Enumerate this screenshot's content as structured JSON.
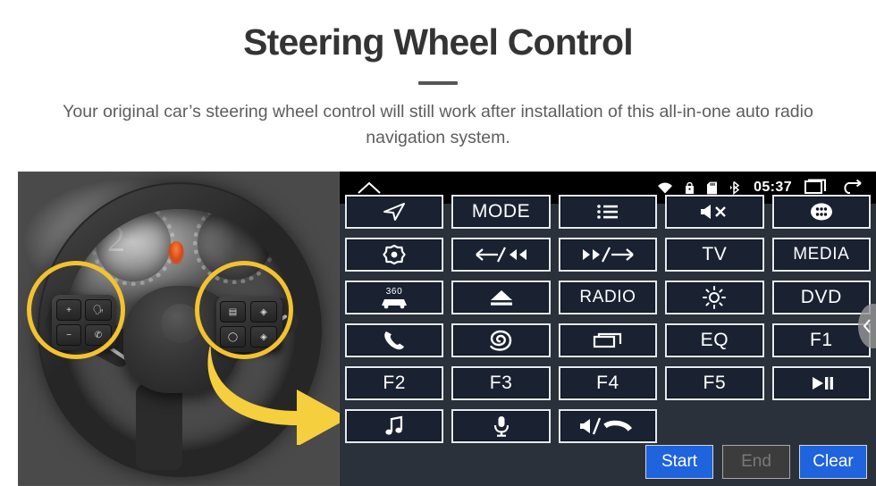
{
  "header": {
    "title": "Steering Wheel Control",
    "subtitle": "Your original car’s steering wheel control will still work after installation of this all-in-one auto radio navigation system."
  },
  "photo": {
    "alt_name": "steering-wheel-photo",
    "highlight_color": "#f2c230",
    "arrow_color": "#f5cf3d",
    "dial_number": "2"
  },
  "unit": {
    "background": "#2b313a",
    "button_fill": "#1a2232",
    "button_border": "#e6eaf2",
    "statusbar": {
      "background": "#000000",
      "home_icon": "home-icon",
      "clock": "05:37",
      "icons": [
        "wifi-icon",
        "lock-icon",
        "sd-card-icon",
        "bluetooth-icon"
      ],
      "recents_icon": "recents-icon",
      "back_icon": "back-icon"
    },
    "buttons": [
      {
        "name": "navigation",
        "label": "",
        "icon": "navigation-arrow-icon"
      },
      {
        "name": "mode",
        "label": "MODE",
        "icon": ""
      },
      {
        "name": "list",
        "label": "",
        "icon": "list-icon"
      },
      {
        "name": "mute",
        "label": "",
        "icon": "mute-icon"
      },
      {
        "name": "apps",
        "label": "",
        "icon": "apps-grid-icon"
      },
      {
        "name": "settings",
        "label": "",
        "icon": "gear-dot-icon"
      },
      {
        "name": "previous",
        "label": "",
        "icon": "prev-track-icon"
      },
      {
        "name": "next",
        "label": "",
        "icon": "next-track-icon"
      },
      {
        "name": "tv",
        "label": "TV",
        "icon": ""
      },
      {
        "name": "media",
        "label": "MEDIA",
        "icon": ""
      },
      {
        "name": "camera-360",
        "label": "360",
        "icon": "car-360-icon"
      },
      {
        "name": "eject",
        "label": "",
        "icon": "eject-icon"
      },
      {
        "name": "radio",
        "label": "RADIO",
        "icon": ""
      },
      {
        "name": "brightness",
        "label": "",
        "icon": "brightness-icon"
      },
      {
        "name": "dvd",
        "label": "DVD",
        "icon": ""
      },
      {
        "name": "phone",
        "label": "",
        "icon": "phone-icon"
      },
      {
        "name": "swirl",
        "label": "",
        "icon": "swirl-icon"
      },
      {
        "name": "window",
        "label": "",
        "icon": "window-icon"
      },
      {
        "name": "eq",
        "label": "EQ",
        "icon": ""
      },
      {
        "name": "f1",
        "label": "F1",
        "icon": ""
      },
      {
        "name": "f2",
        "label": "F2",
        "icon": ""
      },
      {
        "name": "f3",
        "label": "F3",
        "icon": ""
      },
      {
        "name": "f4",
        "label": "F4",
        "icon": ""
      },
      {
        "name": "f5",
        "label": "F5",
        "icon": ""
      },
      {
        "name": "play-pause",
        "label": "",
        "icon": "play-pause-icon"
      },
      {
        "name": "music",
        "label": "",
        "icon": "music-note-icon"
      },
      {
        "name": "voice",
        "label": "",
        "icon": "microphone-icon"
      },
      {
        "name": "speaker-hangup",
        "label": "",
        "icon": "speaker-hangup-icon"
      }
    ],
    "footer": {
      "start_label": "Start",
      "end_label": "End",
      "clear_label": "Clear",
      "start_color": "#1f63dd",
      "end_color": "#3c3c3c",
      "clear_color": "#1f63dd"
    },
    "drawer_handle_icon": "chevron-left-icon"
  }
}
